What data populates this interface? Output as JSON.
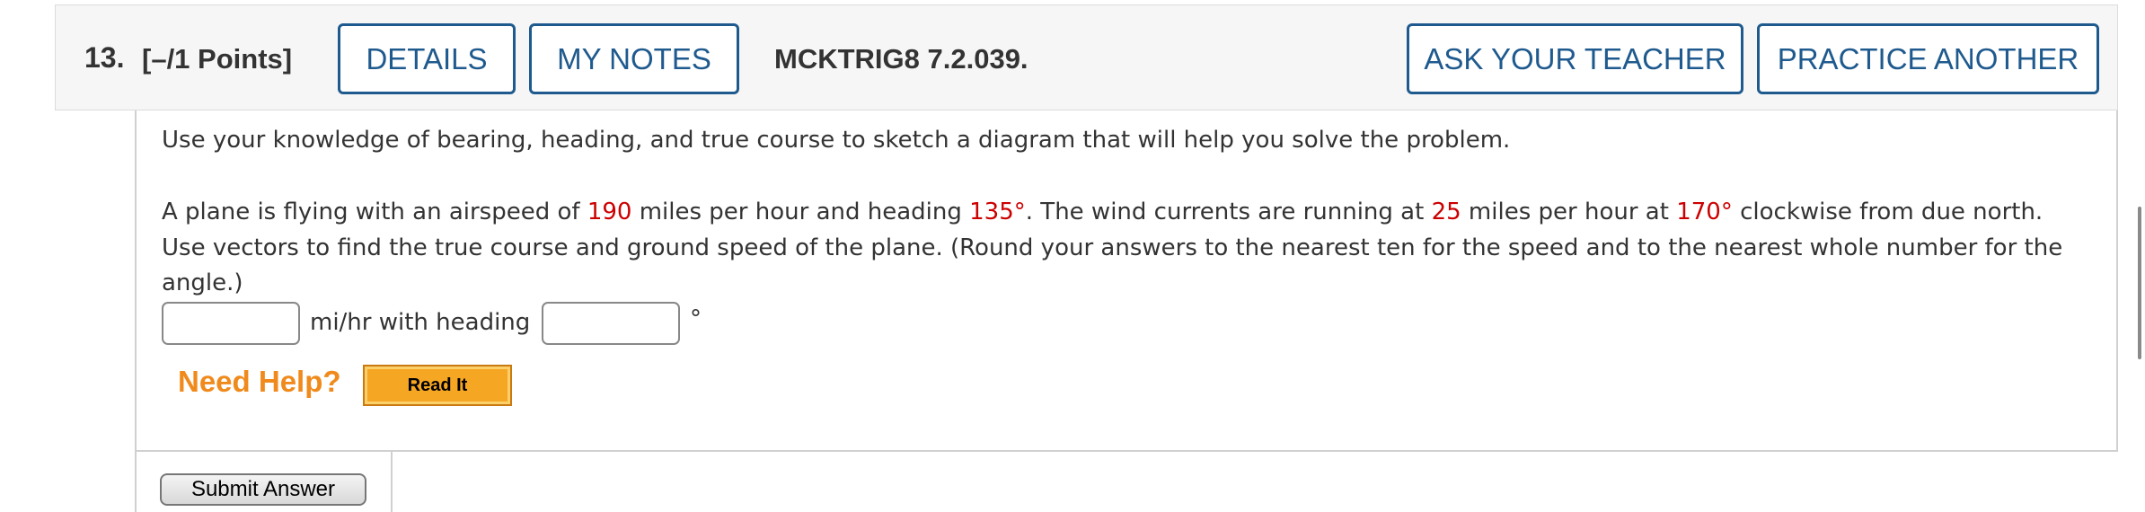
{
  "header": {
    "question_number": "13.",
    "points": "[–/1 Points]",
    "details_label": "DETAILS",
    "my_notes_label": "MY NOTES",
    "assignment_id": "MCKTRIG8 7.2.039.",
    "ask_teacher_label": "ASK YOUR TEACHER",
    "practice_another_label": "PRACTICE ANOTHER"
  },
  "question": {
    "instruction": "Use your knowledge of bearing, heading, and true course to sketch a diagram that will help you solve the problem.",
    "line1": {
      "t1": "A plane is flying with an airspeed of ",
      "v1": "190",
      "t2": " miles per hour and heading ",
      "v2": "135°",
      "t3": ". The wind currents are running at ",
      "v3": "25",
      "t4": " miles per hour at ",
      "v4": "170°",
      "t5": " clockwise from due north."
    },
    "line2": "Use vectors to find the true course and ground speed of the plane. (Round your answers to the nearest ten for the speed and to the nearest whole number for the",
    "line3": "angle.)",
    "answer": {
      "speed_value": "",
      "unit_text": "mi/hr with heading",
      "heading_value": "",
      "degree_symbol": "°"
    }
  },
  "help": {
    "need_help_label": "Need Help?",
    "read_it_label": "Read It"
  },
  "submit_label": "Submit Answer",
  "colors": {
    "accent": "#1f5a8e",
    "value_red": "#cc0000",
    "help_orange": "#f08a1c"
  }
}
